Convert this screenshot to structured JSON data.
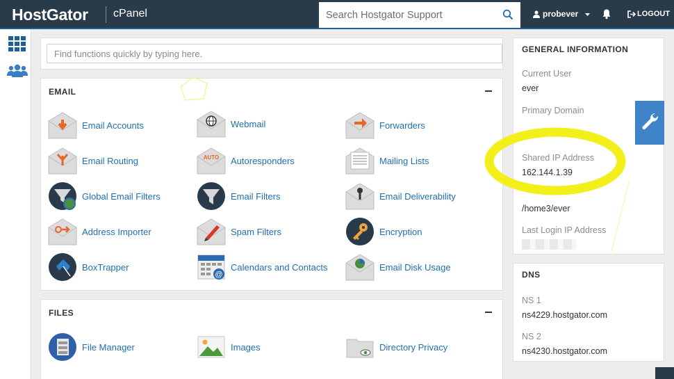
{
  "header": {
    "logo": "HostGator",
    "product": "cPanel",
    "search_placeholder": "Search Hostgator Support",
    "username": "probever",
    "logout": "LOGOUT"
  },
  "quick_search": {
    "placeholder": "Find functions quickly by typing here."
  },
  "email_section": {
    "title": "EMAIL",
    "items": [
      {
        "label": "Email Accounts",
        "icon": "email-accounts-icon"
      },
      {
        "label": "Webmail",
        "icon": "webmail-icon"
      },
      {
        "label": "Forwarders",
        "icon": "forwarders-icon"
      },
      {
        "label": "Email Routing",
        "icon": "email-routing-icon"
      },
      {
        "label": "Autoresponders",
        "icon": "autoresponders-icon"
      },
      {
        "label": "Mailing Lists",
        "icon": "mailing-lists-icon"
      },
      {
        "label": "Global Email Filters",
        "icon": "global-email-filters-icon"
      },
      {
        "label": "Email Filters",
        "icon": "email-filters-icon"
      },
      {
        "label": "Email Deliverability",
        "icon": "email-deliverability-icon"
      },
      {
        "label": "Address Importer",
        "icon": "address-importer-icon"
      },
      {
        "label": "Spam Filters",
        "icon": "spam-filters-icon"
      },
      {
        "label": "Encryption",
        "icon": "encryption-icon"
      },
      {
        "label": "BoxTrapper",
        "icon": "boxtrapper-icon"
      },
      {
        "label": "Calendars and Contacts",
        "icon": "calendars-contacts-icon"
      },
      {
        "label": "Email Disk Usage",
        "icon": "email-disk-usage-icon"
      }
    ],
    "auto_text": "AUTO"
  },
  "files_section": {
    "title": "FILES",
    "items": [
      {
        "label": "File Manager",
        "icon": "file-manager-icon"
      },
      {
        "label": "Images",
        "icon": "images-icon"
      },
      {
        "label": "Directory Privacy",
        "icon": "directory-privacy-icon"
      }
    ]
  },
  "general_info": {
    "title": "GENERAL INFORMATION",
    "current_user_label": "Current User",
    "current_user": "ever",
    "primary_domain_label": "Primary Domain",
    "shared_ip_label": "Shared IP Address",
    "shared_ip": "162.144.1.39",
    "home_dir": "/home3/ever",
    "last_login_label": "Last Login IP Address"
  },
  "dns": {
    "title": "DNS",
    "ns1_label": "NS 1",
    "ns1": "ns4229.hostgator.com",
    "ns2_label": "NS 2",
    "ns2": "ns4230.hostgator.com"
  },
  "colors": {
    "header_bg": "#293a4a",
    "link": "#1f6fb2",
    "highlight": "#f2ef1a",
    "wrench_bg": "#3f84c9"
  }
}
